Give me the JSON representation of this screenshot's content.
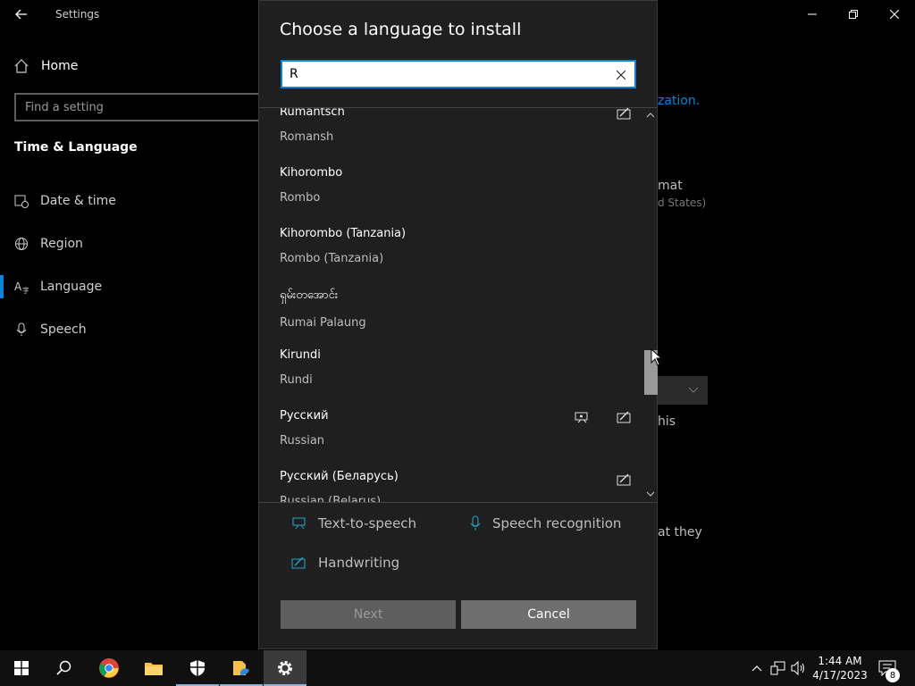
{
  "settings_window": {
    "title": "Settings",
    "home_label": "Home",
    "search_placeholder": "Find a setting",
    "section_title": "Time & Language",
    "nav_items": [
      {
        "label": "Date & time",
        "icon": "calendar-clock-icon"
      },
      {
        "label": "Region",
        "icon": "globe-icon"
      },
      {
        "label": "Language",
        "icon": "language-icon",
        "active": true
      },
      {
        "label": "Speech",
        "icon": "microphone-icon"
      }
    ],
    "background_fragments": {
      "f1": "zation.",
      "f2": "mat",
      "f3": "d States)",
      "f4": "his",
      "f5": "at they"
    }
  },
  "dialog": {
    "title": "Choose a language to install",
    "search_value": "R",
    "languages": [
      {
        "native": "Rumantsch",
        "english": "Romansh",
        "features": [
          "handwriting"
        ]
      },
      {
        "native": "Kihorombo",
        "english": "Rombo",
        "features": []
      },
      {
        "native": "Kihorombo (Tanzania)",
        "english": "Rombo (Tanzania)",
        "features": []
      },
      {
        "native": "ရှမ်းတအောင်း",
        "english": "Rumai Palaung",
        "features": []
      },
      {
        "native": "Kirundi",
        "english": "Rundi",
        "features": []
      },
      {
        "native": "Русский",
        "english": "Russian",
        "features": [
          "text-to-speech",
          "handwriting"
        ]
      },
      {
        "native": "Русский (Беларусь)",
        "english": "Russian (Belarus)",
        "features": [
          "handwriting"
        ]
      }
    ],
    "legend": {
      "tts": "Text-to-speech",
      "speech": "Speech recognition",
      "handwriting": "Handwriting"
    },
    "next_label": "Next",
    "cancel_label": "Cancel"
  },
  "taskbar": {
    "clock_time": "1:44 AM",
    "clock_date": "4/17/2023",
    "notification_count": "8"
  },
  "colors": {
    "accent": "#0a84d6",
    "dialog_bg": "#1f1f1f",
    "taskbar_bg": "#101010"
  }
}
